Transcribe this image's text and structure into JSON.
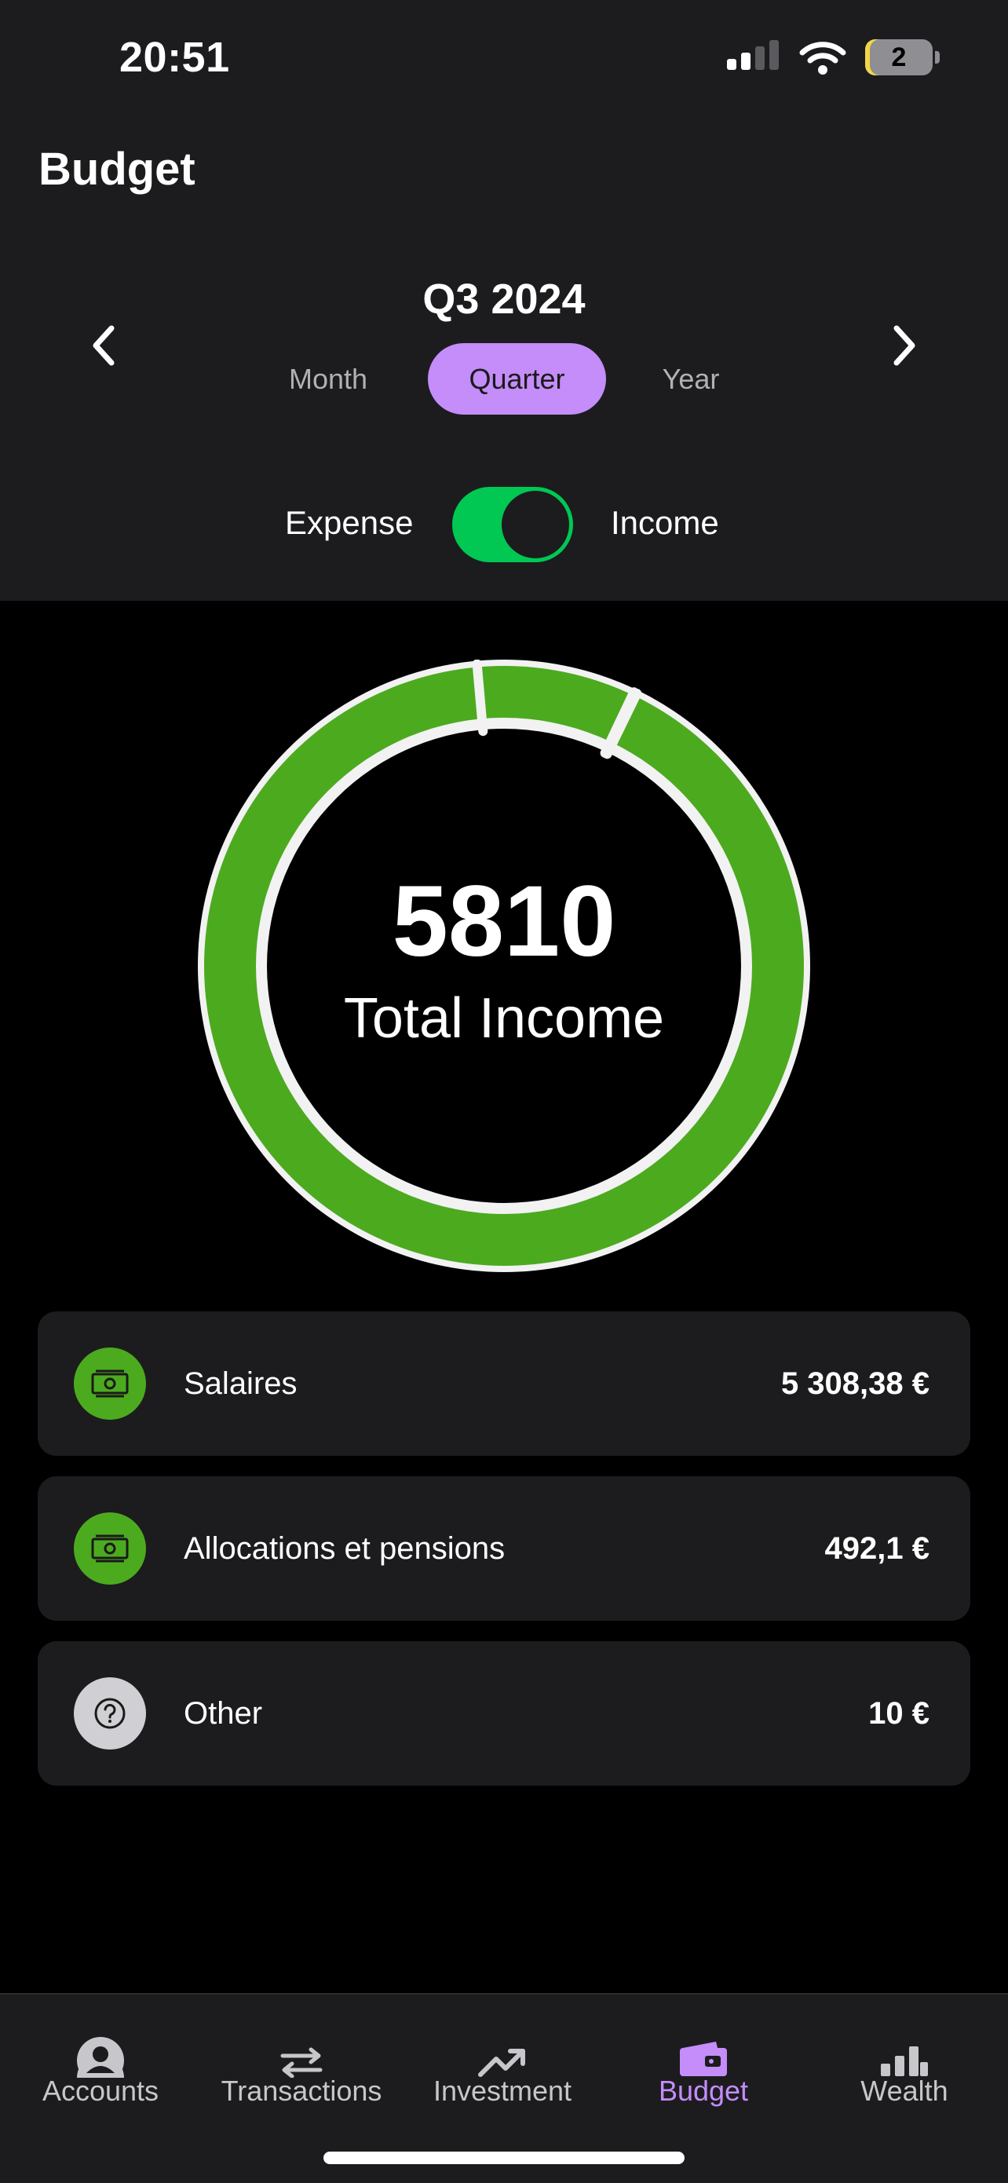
{
  "status_bar": {
    "time": "20:51",
    "battery": "2"
  },
  "header": {
    "title": "Budget"
  },
  "period": {
    "label": "Q3 2024",
    "segments": [
      {
        "label": "Month",
        "selected": false
      },
      {
        "label": "Quarter",
        "selected": true
      },
      {
        "label": "Year",
        "selected": false
      }
    ]
  },
  "toggle": {
    "left_label": "Expense",
    "right_label": "Income",
    "state": "Income"
  },
  "summary": {
    "total": "5810",
    "label": "Total Income"
  },
  "donut_data": {
    "slices": [
      {
        "name": "Salaires",
        "value": 5308.38,
        "color": "#4caa1f"
      },
      {
        "name": "Allocations et pensions",
        "value": 492.1,
        "color": "#4caa1f"
      },
      {
        "name": "Other",
        "value": 10,
        "color": "#4caa1f"
      }
    ]
  },
  "categories": [
    {
      "name": "Salaires",
      "amount": "5 308,38 €",
      "icon": "money-icon",
      "icon_bg": "#4caa1f"
    },
    {
      "name": "Allocations et pensions",
      "amount": "492,1 €",
      "icon": "money-icon",
      "icon_bg": "#4caa1f"
    },
    {
      "name": "Other",
      "amount": "10 €",
      "icon": "question-icon",
      "icon_bg": "#d0d0d4"
    }
  ],
  "tabbar": {
    "items": [
      {
        "label": "Accounts",
        "icon": "person-icon",
        "active": false
      },
      {
        "label": "Transactions",
        "icon": "transfer-arrows-icon",
        "active": false
      },
      {
        "label": "Investment",
        "icon": "trend-up-icon",
        "active": false
      },
      {
        "label": "Budget",
        "icon": "wallet-icon",
        "active": true
      },
      {
        "label": "Wealth",
        "icon": "bar-chart-icon",
        "active": false
      }
    ],
    "accent_color": "#c48dfa"
  }
}
